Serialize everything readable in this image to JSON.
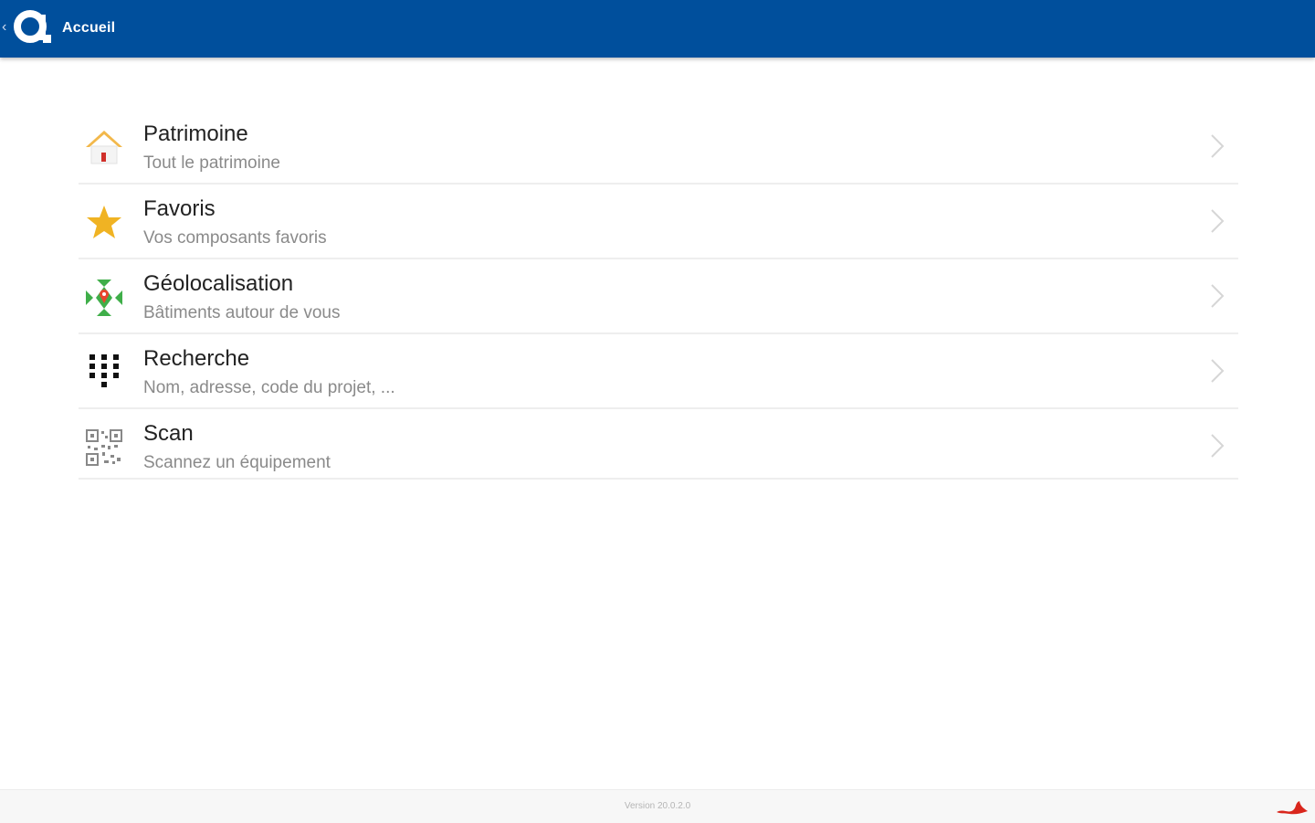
{
  "header": {
    "title": "Accueil",
    "back_glyph": "‹",
    "bg_color": "#004f9c"
  },
  "menu": {
    "items": [
      {
        "title": "Patrimoine",
        "subtitle": "Tout le patrimoine",
        "icon": "house-icon"
      },
      {
        "title": "Favoris",
        "subtitle": "Vos composants favoris",
        "icon": "star-icon"
      },
      {
        "title": "Géolocalisation",
        "subtitle": "Bâtiments autour de vous",
        "icon": "map-pin-icon"
      },
      {
        "title": "Recherche",
        "subtitle": "Nom, adresse, code du projet, ...",
        "icon": "keypad-icon"
      },
      {
        "title": "Scan",
        "subtitle": "Scannez un équipement",
        "icon": "qr-code-icon"
      }
    ]
  },
  "footer": {
    "version": "Version 20.0.2.0"
  }
}
